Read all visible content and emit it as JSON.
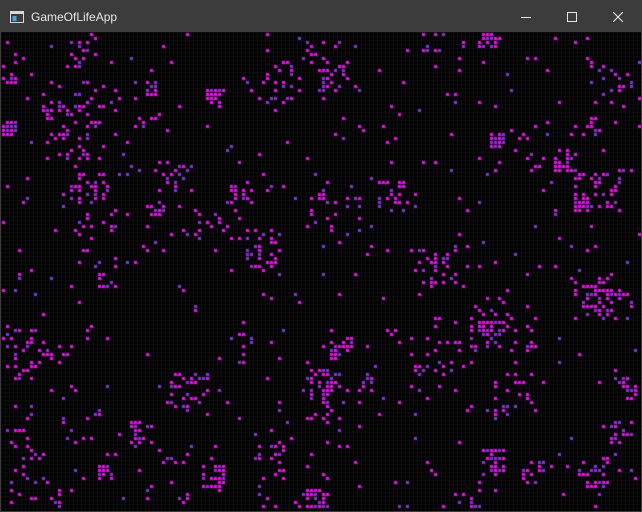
{
  "window": {
    "title": "GameOfLifeApp"
  },
  "colors": {
    "titlebar_bg": "#3c3c3c",
    "title_text": "#e6e6e6",
    "canvas_bg": "#000000",
    "grid_line": "#0f0f0f",
    "cell_primary": "#ff00ff",
    "cell_secondary": "#8a2be2"
  },
  "icons": {
    "app": "app-window-icon",
    "minimize": "minimize-icon",
    "maximize": "maximize-icon",
    "close": "close-icon"
  }
}
